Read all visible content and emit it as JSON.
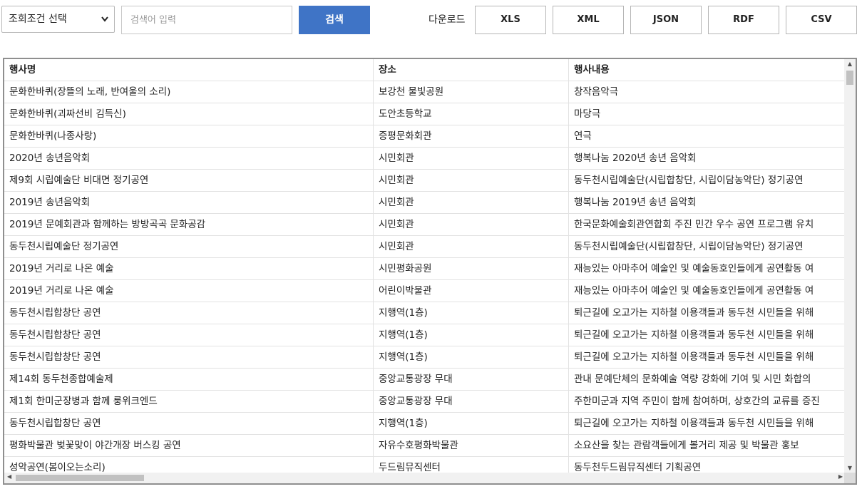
{
  "toolbar": {
    "condition_select": "조회조건 선택",
    "search_placeholder": "검색어 입력",
    "search_button": "검색",
    "download_label": "다운로드",
    "downloads": [
      "XLS",
      "XML",
      "JSON",
      "RDF",
      "CSV"
    ]
  },
  "table": {
    "headers": [
      "행사명",
      "장소",
      "행사내용"
    ],
    "rows": [
      [
        "문화한바퀴(장뜰의 노래, 반여울의 소리)",
        "보강천 물빛공원",
        "창작음악극"
      ],
      [
        "문화한바퀴(괴짜선비 김득신)",
        "도안초등학교",
        "마당극"
      ],
      [
        "문화한바퀴(나종사랑)",
        "증평문화회관",
        "연극"
      ],
      [
        "2020년 송년음악회",
        "시민회관",
        "행복나눔 2020년 송년 음악회"
      ],
      [
        "제9회 시립예술단 비대면 정기공연",
        "시민회관",
        "동두천시립예술단(시립합창단, 시립이담농악단) 정기공연"
      ],
      [
        "2019년 송년음악회",
        "시민회관",
        "행복나눔 2019년 송년 음악회"
      ],
      [
        "2019년 문예회관과 함께하는 방방곡곡 문화공감",
        "시민회관",
        "한국문화예술회관연합회 주진 민간 우수 공연 프로그램 유치"
      ],
      [
        "동두천시립예술단 정기공연",
        "시민회관",
        "동두천시립예술단(시립합창단, 시립이담농악단) 정기공연"
      ],
      [
        "2019년 거리로 나온 예술",
        "시민평화공원",
        "재능있는 아마추어 예술인 및 예술동호인들에게 공연활동 여"
      ],
      [
        "2019년 거리로 나온 예술",
        "어린이박물관",
        "재능있는 아마추어 예술인 및 예술동호인들에게 공연활동 여"
      ],
      [
        "동두천시립합창단 공연",
        "지행역(1층)",
        "퇴근길에 오고가는 지하철 이용객들과 동두천 시민들을 위해"
      ],
      [
        "동두천시립합창단 공연",
        "지행역(1층)",
        "퇴근길에 오고가는 지하철 이용객들과 동두천 시민들을 위해"
      ],
      [
        "동두천시립합창단 공연",
        "지행역(1층)",
        "퇴근길에 오고가는 지하철 이용객들과 동두천 시민들을 위해"
      ],
      [
        "제14회 동두천종합예술제",
        "중앙교통광장 무대",
        "관내 문예단체의 문화예술 역량 강화에 기여 및 시민 화합의"
      ],
      [
        "제1회 한미군장병과 함께 룽위크엔드",
        "중앙교통광장 무대",
        "주한미군과 지역 주민이 함께 참여하며, 상호간의 교류를 증진"
      ],
      [
        "동두천시립합창단 공연",
        "지행역(1층)",
        "퇴근길에 오고가는 지하철 이용객들과 동두천 시민들을 위해"
      ],
      [
        "평화박물관 벚꽃맞이 야간개장 버스킹 공연",
        "자유수호평화박물관",
        "소요산을 찾는 관람객들에게 볼거리 제공 및 박물관 홍보"
      ],
      [
        "성악공연(봄이오는소리)",
        "두드림뮤직센터",
        "동두천두드림뮤직센터 기획공연"
      ]
    ]
  }
}
